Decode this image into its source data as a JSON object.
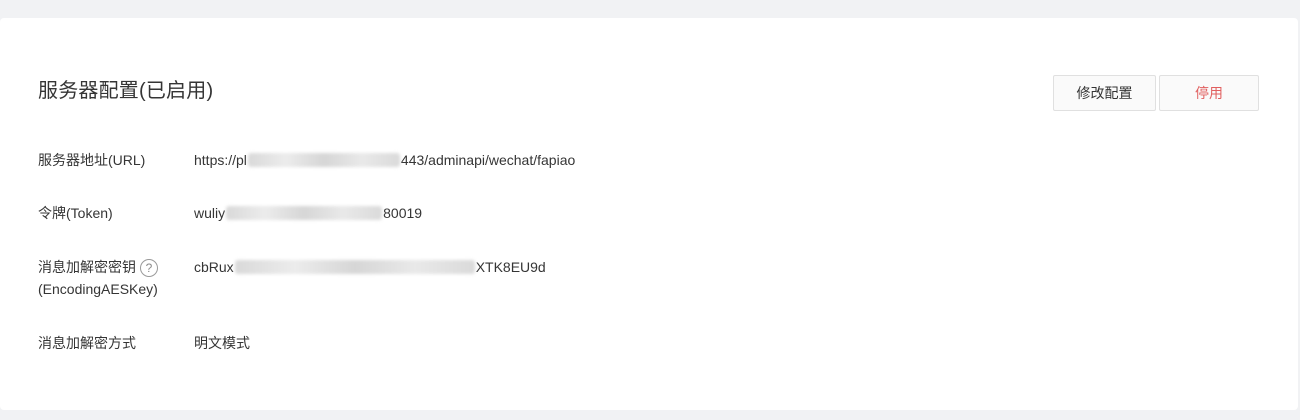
{
  "panel": {
    "title": "服务器配置(已启用)",
    "edit_button": "修改配置",
    "disable_button": "停用"
  },
  "fields": [
    {
      "label": "服务器地址(URL)",
      "value_prefix": "https://pl",
      "value_suffix": "443/adminapi/wechat/fapiao"
    },
    {
      "label": "令牌(Token)",
      "value_prefix": "wuliy",
      "value_suffix": "80019"
    },
    {
      "label_line1": "消息加解密密钥",
      "label_line2": "(EncodingAESKey)",
      "help_icon": "?",
      "value_prefix": "cbRux",
      "value_suffix": "XTK8EU9d"
    },
    {
      "label": "消息加解密方式",
      "value": "明文模式"
    }
  ],
  "colors": {
    "danger": "#e15f5f",
    "background": "#f1f2f4",
    "card": "#ffffff"
  }
}
